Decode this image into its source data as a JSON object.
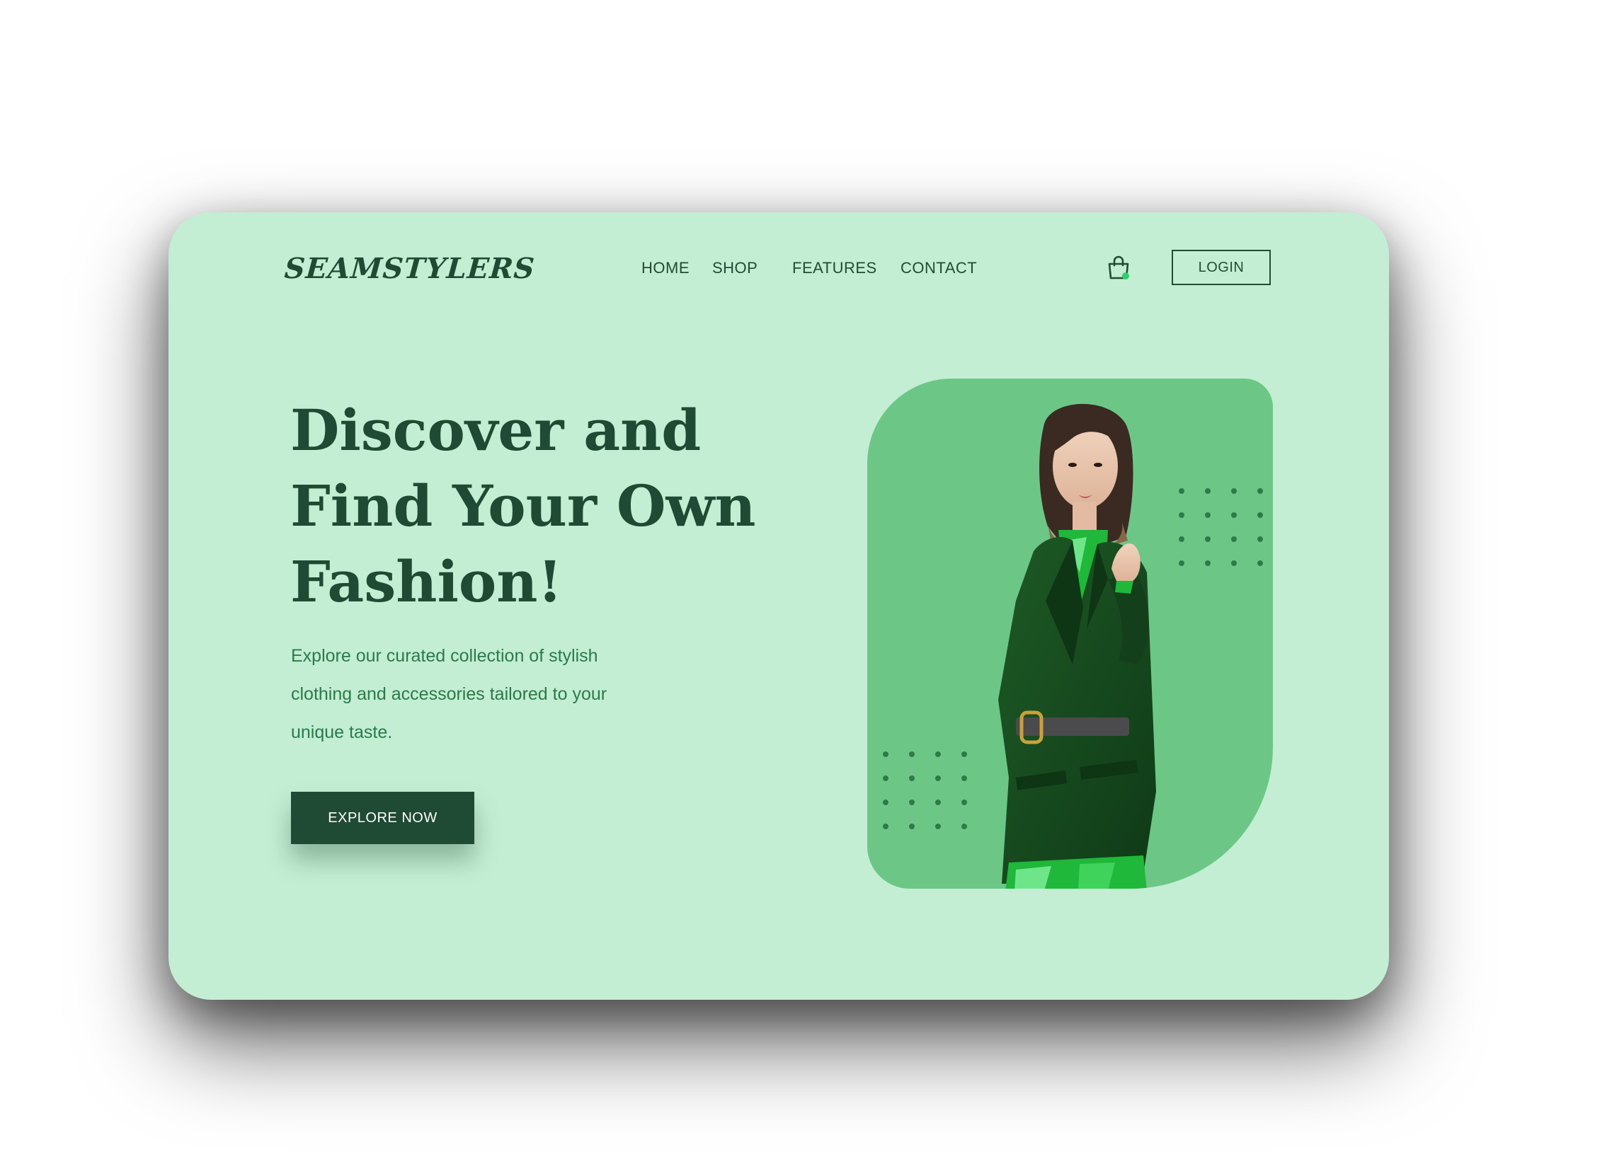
{
  "brand": {
    "logo_text": "SEAMSTYLERS"
  },
  "nav": {
    "items": [
      {
        "label": "HOME"
      },
      {
        "label": "SHOP"
      },
      {
        "label": "FEATURES"
      },
      {
        "label": "CONTACT"
      }
    ]
  },
  "header": {
    "cart_icon": "shopping-bag-icon",
    "cart_indicator_color": "#2fd06a",
    "login_label": "LOGIN"
  },
  "hero": {
    "headline_lines": [
      "Discover and",
      "Find Your Own",
      "Fashion!"
    ],
    "subtext_lines": [
      "Explore our curated collection of stylish",
      "clothing and accessories tailored to your",
      "unique taste."
    ],
    "cta_label": "EXPLORE NOW"
  },
  "colors": {
    "background": "#c3eed3",
    "primary_dark": "#1f4a33",
    "accent_text": "#2a7a4a",
    "panel": "#6cc786"
  }
}
